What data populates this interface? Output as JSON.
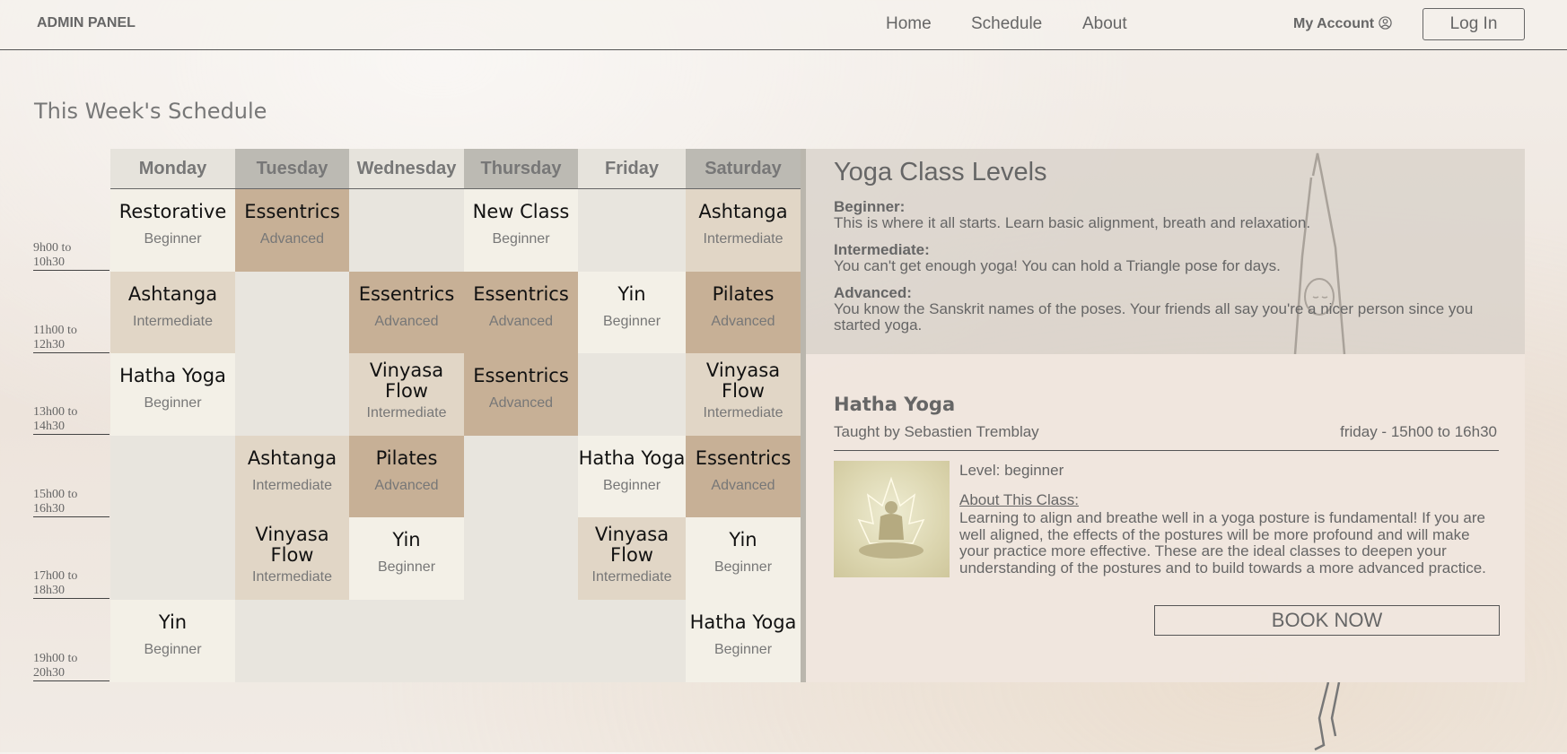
{
  "header": {
    "brand": "ADMIN PANEL",
    "nav": [
      "Home",
      "Schedule",
      "About"
    ],
    "account_label": "My Account",
    "account_icon": "user-circle-icon",
    "login_label": "Log In"
  },
  "page_title": "This Week's Schedule",
  "schedule": {
    "days": [
      "Monday",
      "Tuesday",
      "Wednesday",
      "Thursday",
      "Friday",
      "Saturday"
    ],
    "time_slots": [
      [
        "9h00 to",
        "10h30"
      ],
      [
        "11h00 to",
        "12h30"
      ],
      [
        "13h00 to",
        "14h30"
      ],
      [
        "15h00 to",
        "16h30"
      ],
      [
        "17h00 to",
        "18h30"
      ],
      [
        "19h00 to",
        "20h30"
      ]
    ],
    "classes": {
      "mon_0": {
        "name": "Restorative",
        "level": "Beginner"
      },
      "mon_1": {
        "name": "Ashtanga",
        "level": "Intermediate"
      },
      "mon_2": {
        "name": "Hatha Yoga",
        "level": "Beginner"
      },
      "mon_5": {
        "name": "Yin",
        "level": "Beginner"
      },
      "tue_0": {
        "name": "Essentrics",
        "level": "Advanced"
      },
      "tue_3": {
        "name": "Ashtanga",
        "level": "Intermediate"
      },
      "tue_4": {
        "name": "Vinyasa Flow",
        "level": "Intermediate"
      },
      "wed_1": {
        "name": "Essentrics",
        "level": "Advanced"
      },
      "wed_2": {
        "name": "Vinyasa Flow",
        "level": "Intermediate"
      },
      "wed_3": {
        "name": "Pilates",
        "level": "Advanced"
      },
      "wed_4": {
        "name": "Yin",
        "level": "Beginner"
      },
      "thu_0": {
        "name": "New Class",
        "level": "Beginner"
      },
      "thu_1": {
        "name": "Essentrics",
        "level": "Advanced"
      },
      "thu_2": {
        "name": "Essentrics",
        "level": "Advanced"
      },
      "fri_1": {
        "name": "Yin",
        "level": "Beginner"
      },
      "fri_3": {
        "name": "Hatha Yoga",
        "level": "Beginner"
      },
      "fri_4": {
        "name": "Vinyasa Flow",
        "level": "Intermediate"
      },
      "sat_0": {
        "name": "Ashtanga",
        "level": "Intermediate"
      },
      "sat_1": {
        "name": "Pilates",
        "level": "Advanced"
      },
      "sat_2": {
        "name": "Vinyasa Flow",
        "level": "Intermediate"
      },
      "sat_3": {
        "name": "Essentrics",
        "level": "Advanced"
      },
      "sat_4": {
        "name": "Yin",
        "level": "Beginner"
      },
      "sat_5": {
        "name": "Hatha Yoga",
        "level": "Beginner"
      }
    },
    "level_colors": {
      "Beginner": "#f3f0e7",
      "Intermediate": "#e1d6c6",
      "Advanced": "#c7b096",
      "empty": "#e8e5de"
    },
    "header_colors": {
      "light": "#e6e3dc",
      "dark": "#bcbab3"
    }
  },
  "levels": {
    "title": "Yoga Class Levels",
    "items": [
      {
        "label": "Beginner:",
        "text": "This is where it all starts. Learn basic alignment, breath and relaxation."
      },
      {
        "label": "Intermediate:",
        "text": "You can't get enough yoga! You can hold a Triangle pose for days."
      },
      {
        "label": "Advanced:",
        "text": "You know the Sanskrit names of the poses. Your friends all say you're a nicer person since you started yoga."
      }
    ]
  },
  "detail": {
    "title": "Hatha Yoga",
    "taught_by": "Taught by Sebastien Tremblay",
    "when": "friday - 15h00 to 16h30",
    "level": "Level: beginner",
    "about_heading": "About This Class:",
    "about_text": "Learning to align and breathe well in a yoga posture is fundamental! If you are well aligned, the effects of the postures will be more profound and will make your practice more effective. These are the ideal classes to deepen your understanding of the postures and to build towards a more advanced practice.",
    "book_label": "BOOK NOW"
  }
}
